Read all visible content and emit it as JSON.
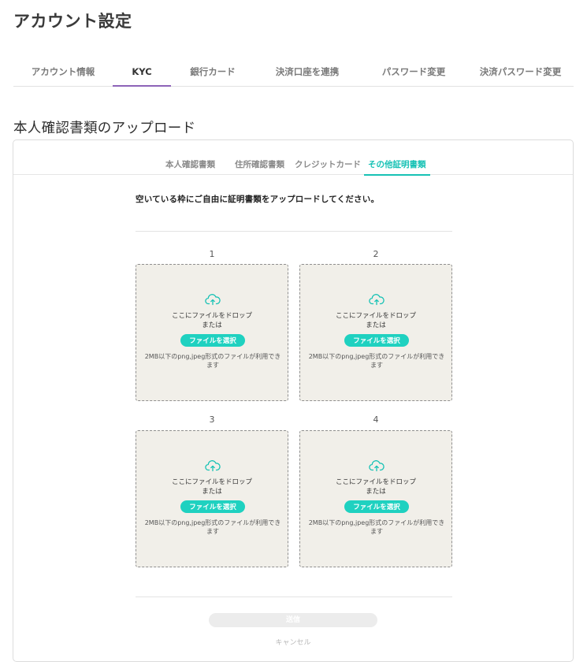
{
  "page": {
    "title": "アカウント設定"
  },
  "main_tabs": [
    {
      "label": "アカウント情報"
    },
    {
      "label": "KYC"
    },
    {
      "label": "銀行カード"
    },
    {
      "label": "決済口座を連携"
    },
    {
      "label": "パスワード変更"
    },
    {
      "label": "決済パスワード変更"
    }
  ],
  "main_tabs_active": "KYC",
  "section": {
    "title": "本人確認書類のアップロード"
  },
  "sub_tabs": [
    {
      "label": "本人確認書類"
    },
    {
      "label": "住所確認書類"
    },
    {
      "label": "クレジットカード"
    },
    {
      "label": "その他証明書類"
    }
  ],
  "sub_tabs_active": "その他証明書類",
  "instruction": "空いている枠にご自由に証明書類をアップロードしてください。",
  "slots": [
    {
      "number": "1",
      "drop_text": "ここにファイルをドロップ",
      "or_text": "または",
      "button_label": "ファイルを選択",
      "note": "2MB以下のpng,jpeg形式のファイルが利用できます"
    },
    {
      "number": "2",
      "drop_text": "ここにファイルをドロップ",
      "or_text": "または",
      "button_label": "ファイルを選択",
      "note": "2MB以下のpng,jpeg形式のファイルが利用できます"
    },
    {
      "number": "3",
      "drop_text": "ここにファイルをドロップ",
      "or_text": "または",
      "button_label": "ファイルを選択",
      "note": "2MB以下のpng,jpeg形式のファイルが利用できます"
    },
    {
      "number": "4",
      "drop_text": "ここにファイルをドロップ",
      "or_text": "または",
      "button_label": "ファイルを選択",
      "note": "2MB以下のpng,jpeg形式のファイルが利用できます"
    }
  ],
  "icons": {
    "upload": "cloud-upload-icon"
  },
  "colors": {
    "accent": "#17c2b5",
    "button": "#1fd1c0",
    "kyc_tab_underline": "#8d63b8",
    "dropzone_bg": "#f1efe9"
  },
  "actions": {
    "submit_label": "送信",
    "cancel_label": "キャンセル"
  }
}
